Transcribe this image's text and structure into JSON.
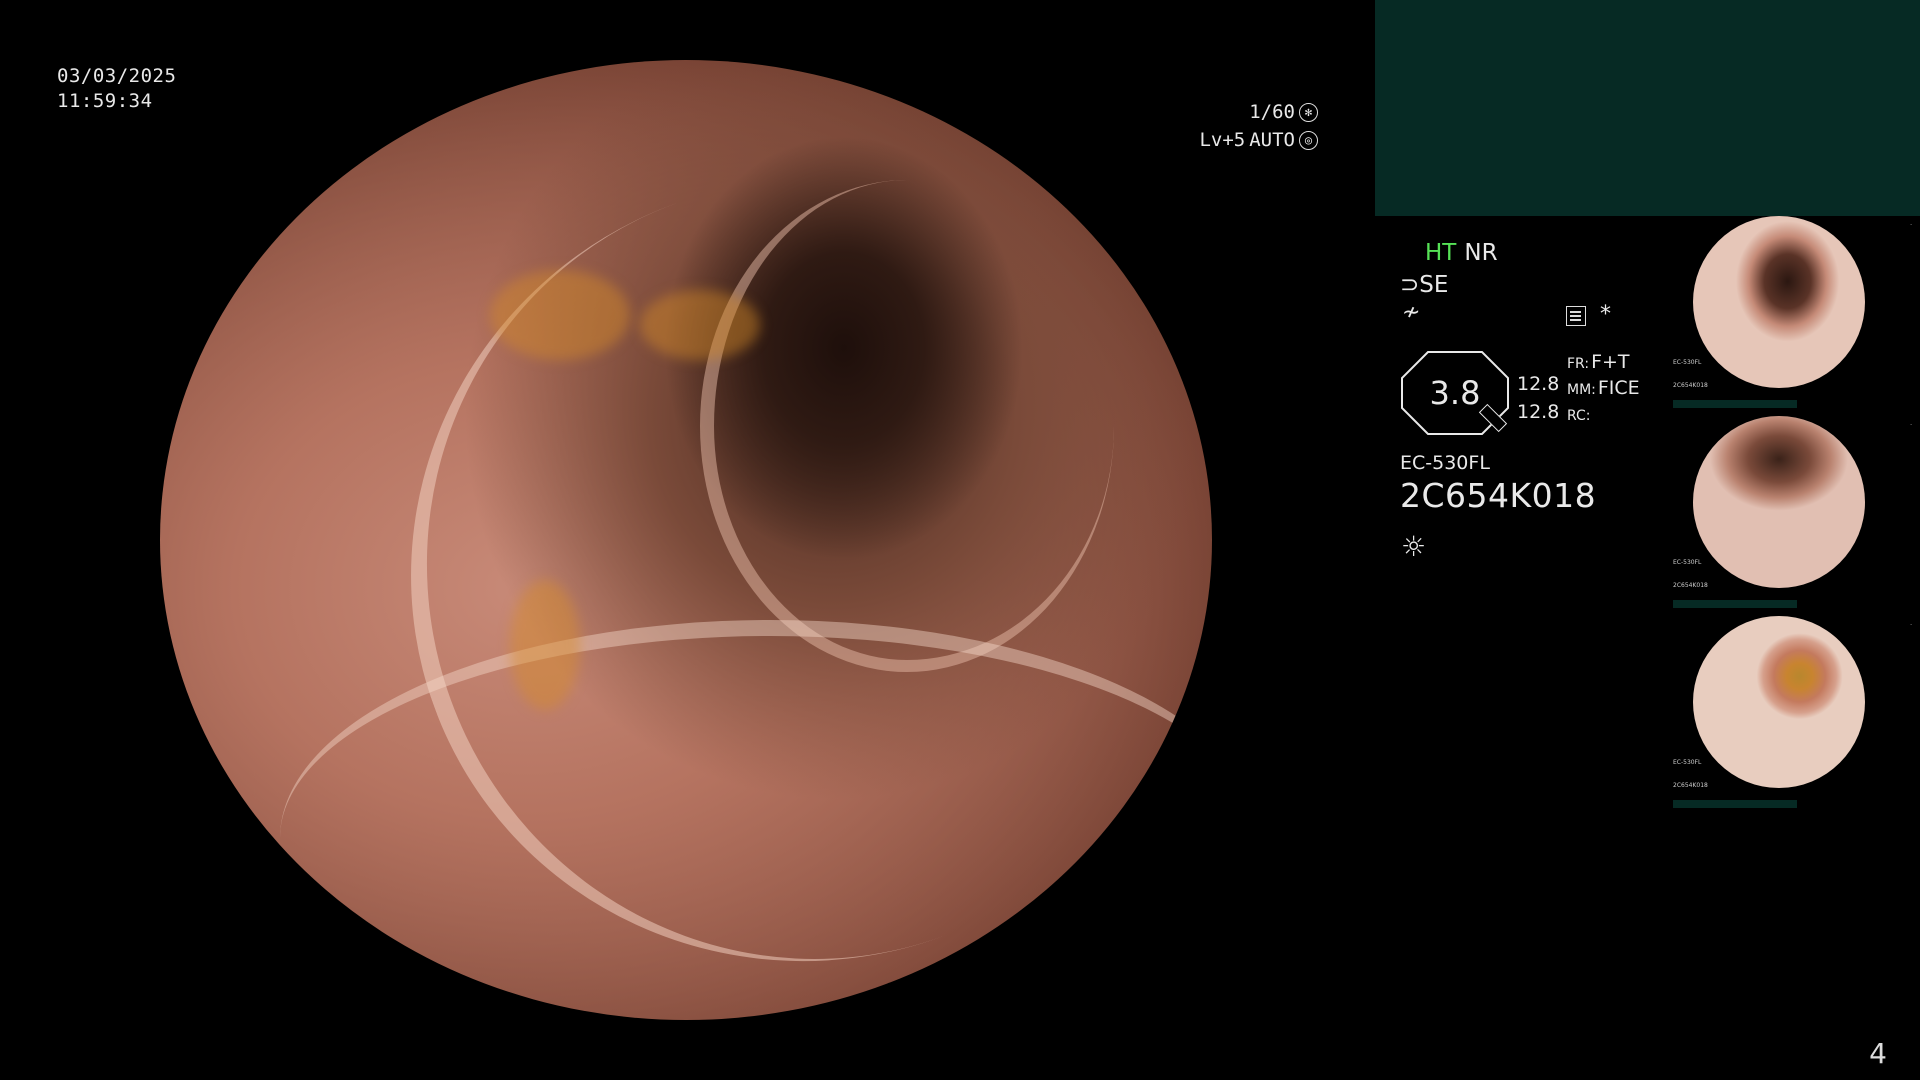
{
  "datetime": {
    "date": "03/03/2025",
    "time": "11:59:34"
  },
  "exposure": {
    "shutter": "1/60",
    "shutter_icon": "aperture-icon",
    "level": "Lv+5",
    "mode": "AUTO",
    "mode_icon": "iris-icon"
  },
  "status": {
    "ht": "HT",
    "nr": "NR",
    "se_symbol": "⊃",
    "se": "SE",
    "filter_symbol": "≁",
    "menu_icon": "menu-icon",
    "star": "*",
    "gauge_value": "3.8",
    "num1": "12.8",
    "num2": "12.8",
    "fr_key": "FR:",
    "fr_val": "F+T",
    "mm_key": "MM:",
    "mm_val": "FICE",
    "rc_key": "RC:",
    "model": "EC-530FL",
    "serial": "2C654K018",
    "light_icon": "☼"
  },
  "thumbnails": [
    {
      "model": "EC-530FL",
      "serial": "2C654K018"
    },
    {
      "model": "EC-530FL",
      "serial": "2C654K018"
    },
    {
      "model": "EC-530FL",
      "serial": "2C654K018"
    }
  ],
  "page_number": "4",
  "colors": {
    "panel": "#062a24",
    "ht_green": "#56e256",
    "background": "#000000"
  }
}
